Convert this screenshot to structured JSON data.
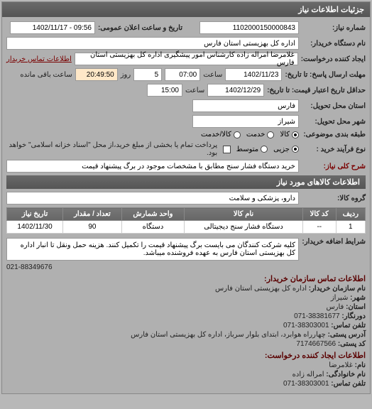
{
  "panel": {
    "title": "جزئیات اطلاعات نیاز"
  },
  "fields": {
    "number_label": "شماره نیاز:",
    "number_value": "1102000150000843",
    "datetime_label": "تاریخ و ساعت اعلان عمومی:",
    "datetime_value": "09:56 - 1402/11/17",
    "device_label": "نام دستگاه خریدار:",
    "device_value": "اداره کل بهزیستی استان فارس",
    "requester_label": "ایجاد کننده درخواست:",
    "requester_value": "غلامرضا امراله زاده کارشناس امور پیشگیری اداره کل بهزیستی استان فارس",
    "contact_link": "اطلاعات تماس خریدار",
    "deadline_from_label": "مهلت ارسال پاسخ: تا تاریخ:",
    "deadline_date": "1402/11/23",
    "time_label": "ساعت",
    "deadline_time": "07:00",
    "day_label": "روز",
    "day_value": "5",
    "remaining_time": "20:49:50",
    "remaining_label": "ساعت باقی مانده",
    "validity_label": "حداقل تاریخ اعتبار قیمت: تا تاریخ:",
    "validity_date": "1402/12/29",
    "validity_time": "15:00",
    "province_label": "استان محل تحویل:",
    "province_value": "فارس",
    "city_label": "شهر محل تحویل:",
    "city_value": "شیراز",
    "category_label": "طبقه بندی موضوعی:",
    "cat_all": "کالا",
    "cat_service": "خدمت",
    "cat_both": "کالا/خدمت",
    "process_label": "نوع فرآیند خرید :",
    "proc_small": "جزیی",
    "proc_medium": "متوسط",
    "proc_note": "پرداخت تمام یا بخشی از مبلغ خرید،از محل \"اسناد خزانه اسلامی\" خواهد بود.",
    "desc_label": "شرح کلی نیاز:",
    "desc_value": "خرید دستگاه فشار سنج مطابق با مشخصات موجود در برگ پیشنهاد قیمت"
  },
  "goods_section": "اطلاعات کالاهای مورد نیاز",
  "group_label": "گروه کالا:",
  "group_value": "دارو، پزشکی و سلامت",
  "table": {
    "headers": [
      "ردیف",
      "کد کالا",
      "نام کالا",
      "واحد شمارش",
      "تعداد / مقدار",
      "تاریخ نیاز"
    ],
    "row": [
      "1",
      "--",
      "دستگاه فشار سنج دیجیتالی",
      "دستگاه",
      "90",
      "1402/11/30"
    ]
  },
  "buyer_note_label": "شرایط اضافه خریدار:",
  "buyer_note_value": "کلیه شرکت کنندگان می بایست برگ پیشنهاد قیمت را تکمیل کنند. هزینه حمل ونقل تا انبار اداره کل بهزیستی استان فارس به عهده فروشنده میباشد.",
  "phone_bottom": "021-88349676",
  "contact_section": "اطلاعات تماس سازمان خریدار:",
  "org_name_label": "نام سازمان خریدار:",
  "org_name_value": "اداره کل بهزیستی استان فارس",
  "c_city_label": "شهر:",
  "c_city_value": "شیراز",
  "c_prov_label": "استان:",
  "c_prov_value": "فارس",
  "fax_label": "دورنگار:",
  "fax_value": "38381677-071",
  "tel_label": "تلفن تماس:",
  "tel_value": "38303001-071",
  "addr_label": "آدرس پستی:",
  "addr_value": "چهارراه هوابرد، ابتدای بلوار سرباز، اداره کل بهزیستی استان فارس",
  "zip_label": "کد پستی:",
  "zip_value": "7174667566",
  "creator_section": "اطلاعات ایجاد کننده درخواست:",
  "name_label": "نام:",
  "name_value": "غلامرضا",
  "family_label": "نام خانوادگی:",
  "family_value": "امراله زاده",
  "tel2_label": "تلفن تماس:",
  "tel2_value": "38303001-071"
}
